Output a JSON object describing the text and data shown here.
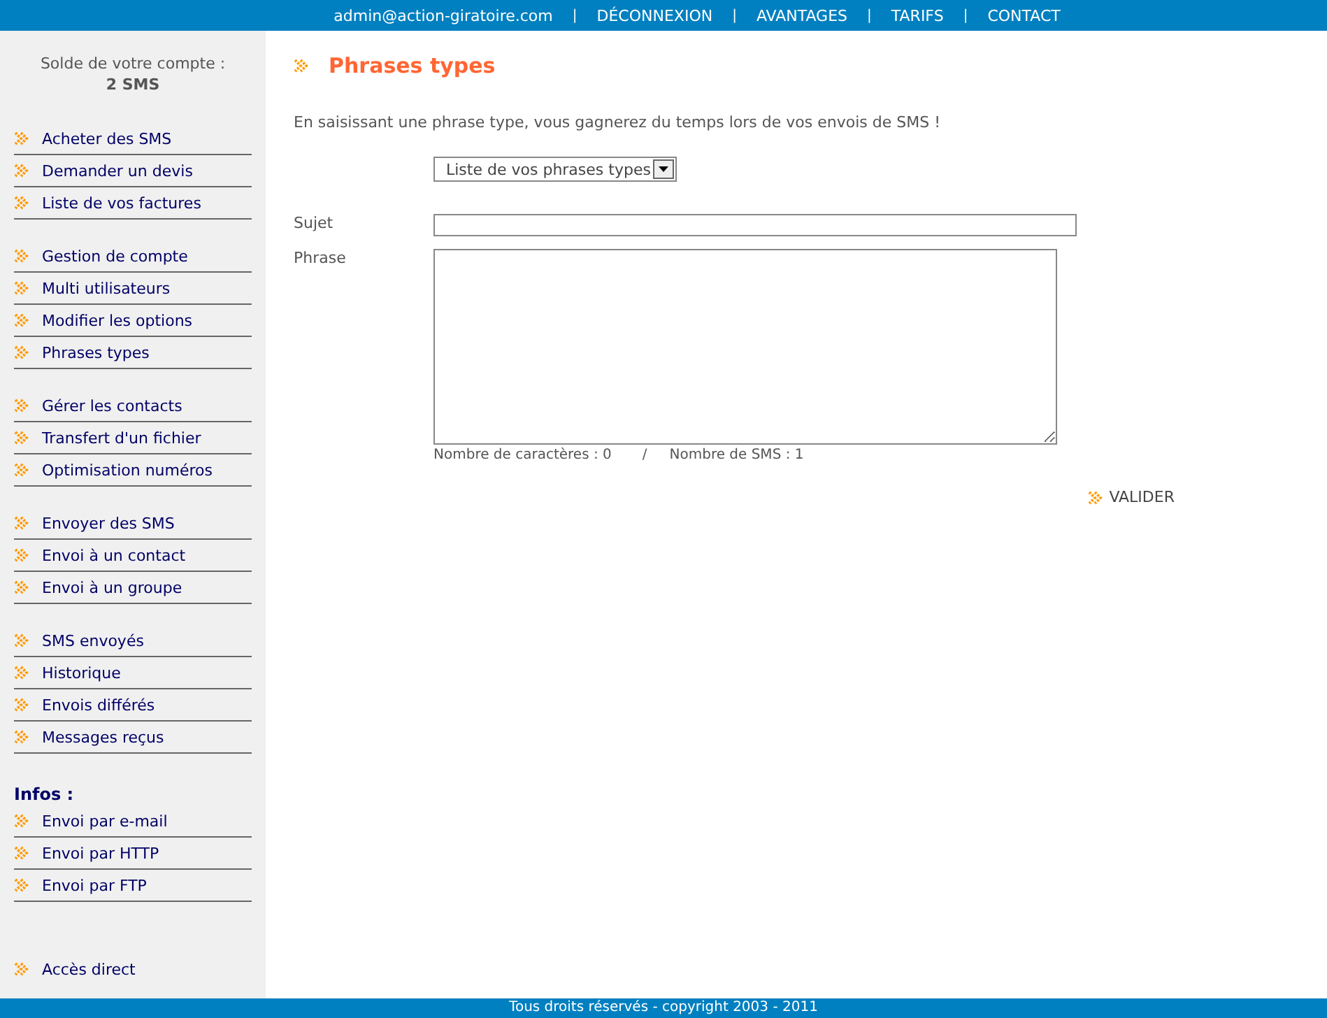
{
  "top_nav": [
    {
      "kind": "link",
      "text": "admin@action-giratoire.com"
    },
    {
      "kind": "separator",
      "text": "|"
    },
    {
      "kind": "link",
      "text": "DÉCONNEXION"
    },
    {
      "kind": "separator",
      "text": "|"
    },
    {
      "kind": "link",
      "text": "AVANTAGES"
    },
    {
      "kind": "separator",
      "text": "|"
    },
    {
      "kind": "link",
      "text": "TARIFS"
    },
    {
      "kind": "separator",
      "text": "|"
    },
    {
      "kind": "link",
      "text": "CONTACT"
    }
  ],
  "sidebar": {
    "balance_label": "Solde de votre compte :",
    "balance_value": "2 SMS",
    "groups": [
      {
        "items": [
          "Acheter des SMS",
          "Demander un devis",
          "Liste de vos factures"
        ]
      },
      {
        "items": [
          "Gestion de compte",
          "Multi utilisateurs",
          "Modifier les options",
          "Phrases types"
        ]
      },
      {
        "items": [
          "Gérer les contacts",
          "Transfert d'un fichier",
          "Optimisation numéros"
        ]
      },
      {
        "items": [
          "Envoyer des SMS",
          "Envoi à un contact",
          "Envoi à un groupe"
        ]
      },
      {
        "items": [
          "SMS envoyés",
          "Historique",
          "Envois différés",
          "Messages reçus"
        ]
      },
      {
        "heading": "Infos :",
        "items": [
          "Envoi par e-mail",
          "Envoi par HTTP",
          "Envoi par FTP"
        ]
      }
    ],
    "direct_link": "Accès direct"
  },
  "page": {
    "title": "Phrases types",
    "intro": "En saisissant une phrase type, vous gagnerez du temps lors de vos envois de SMS !",
    "select": {
      "value": "Liste de vos phrases types"
    },
    "subject_label": "Sujet",
    "phrase_label": "Phrase",
    "char_count": "Nombre de caractères : 0",
    "count_separator": "/",
    "sms_count": "Nombre de SMS : 1",
    "submit": "VALIDER"
  },
  "footer": "Tous droits réservés - copyright 2003 - 2011"
}
